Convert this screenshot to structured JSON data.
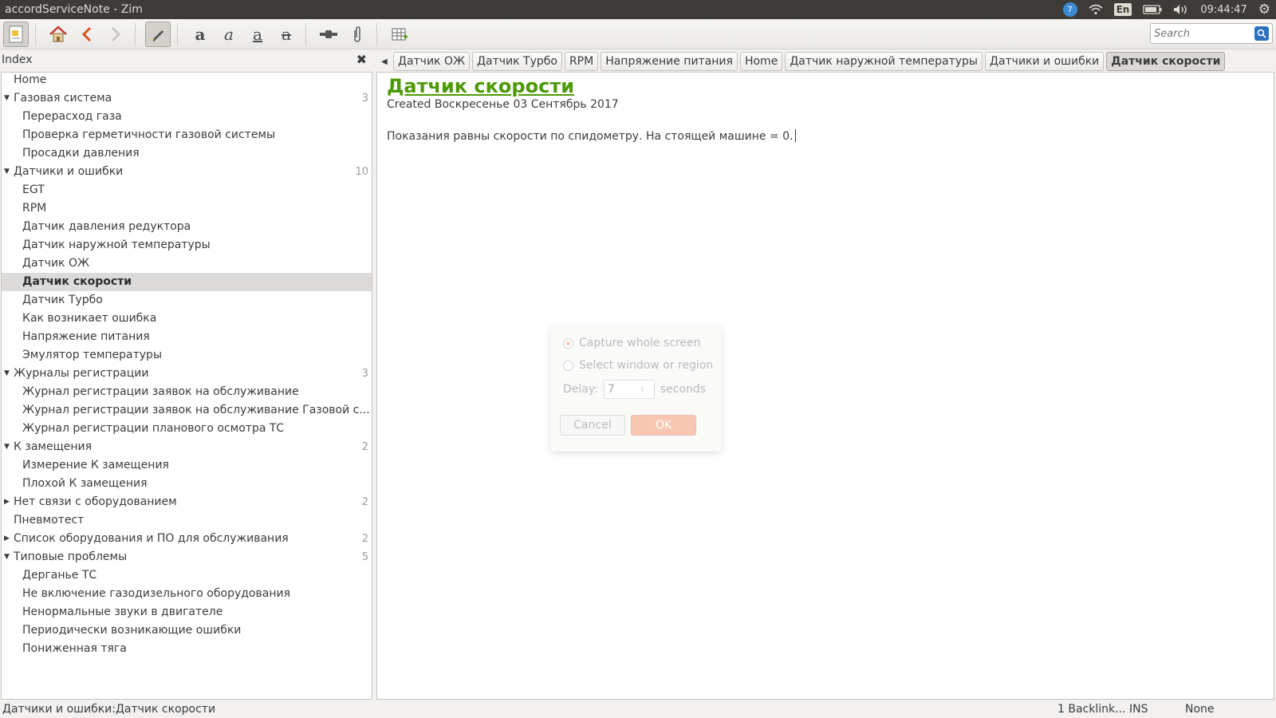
{
  "window": {
    "title": "accordServiceNote - Zim"
  },
  "system_tray": {
    "telegram_badge": "7",
    "keyboard_layout": "En",
    "clock": "09:44:47",
    "icons": [
      "telegram-icon",
      "wifi-icon",
      "keyboard-icon",
      "battery-icon",
      "volume-icon",
      "clock",
      "settings-gear-icon"
    ]
  },
  "toolbar": {
    "buttons": [
      "notebook-icon",
      "home-icon",
      "back-icon",
      "forward-icon",
      "edit-pencil-icon",
      "bold-icon",
      "italic-icon",
      "underline-icon",
      "strikethrough-icon",
      "insert-link-icon",
      "attach-file-icon",
      "table-icon"
    ],
    "search_placeholder": "Search"
  },
  "index": {
    "header": "Index",
    "items": [
      {
        "label": "Home",
        "level": 0,
        "expander": "",
        "count": ""
      },
      {
        "label": "Газовая система",
        "level": 0,
        "expander": "▼",
        "count": "3"
      },
      {
        "label": "Перерасход газа",
        "level": 1,
        "expander": "",
        "count": ""
      },
      {
        "label": "Проверка герметичности газовой системы",
        "level": 1,
        "expander": "",
        "count": ""
      },
      {
        "label": "Просадки давления",
        "level": 1,
        "expander": "",
        "count": ""
      },
      {
        "label": "Датчики и ошибки",
        "level": 0,
        "expander": "▼",
        "count": "10"
      },
      {
        "label": "EGT",
        "level": 1,
        "expander": "",
        "count": ""
      },
      {
        "label": "RPM",
        "level": 1,
        "expander": "",
        "count": ""
      },
      {
        "label": "Датчик давления редуктора",
        "level": 1,
        "expander": "",
        "count": ""
      },
      {
        "label": "Датчик наружной температуры",
        "level": 1,
        "expander": "",
        "count": ""
      },
      {
        "label": "Датчик ОЖ",
        "level": 1,
        "expander": "",
        "count": ""
      },
      {
        "label": "Датчик скорости",
        "level": 1,
        "expander": "",
        "count": "",
        "selected": true
      },
      {
        "label": "Датчик Турбо",
        "level": 1,
        "expander": "",
        "count": ""
      },
      {
        "label": "Как возникает ошибка",
        "level": 1,
        "expander": "",
        "count": ""
      },
      {
        "label": "Напряжение питания",
        "level": 1,
        "expander": "",
        "count": ""
      },
      {
        "label": "Эмулятор температуры",
        "level": 1,
        "expander": "",
        "count": ""
      },
      {
        "label": "Журналы регистрации",
        "level": 0,
        "expander": "▼",
        "count": "3"
      },
      {
        "label": "Журнал регистрации заявок на обслуживание",
        "level": 1,
        "expander": "",
        "count": ""
      },
      {
        "label": "Журнал регистрации заявок на обслуживание Газовой с...",
        "level": 1,
        "expander": "",
        "count": ""
      },
      {
        "label": "Журнал регистрации планового осмотра ТС",
        "level": 1,
        "expander": "",
        "count": ""
      },
      {
        "label": "К замещения",
        "level": 0,
        "expander": "▼",
        "count": "2"
      },
      {
        "label": "Измерение К замещения",
        "level": 1,
        "expander": "",
        "count": ""
      },
      {
        "label": "Плохой К замещения",
        "level": 1,
        "expander": "",
        "count": ""
      },
      {
        "label": "Нет связи с оборудованием",
        "level": 0,
        "expander": "▶",
        "count": "2"
      },
      {
        "label": "Пневмотест",
        "level": 0,
        "expander": "",
        "count": ""
      },
      {
        "label": "Список оборудования и ПО для обслуживания",
        "level": 0,
        "expander": "▶",
        "count": "2"
      },
      {
        "label": "Типовые проблемы",
        "level": 0,
        "expander": "▼",
        "count": "5"
      },
      {
        "label": "Дерганье ТС",
        "level": 1,
        "expander": "",
        "count": ""
      },
      {
        "label": "Не включение газодизельного оборудования",
        "level": 1,
        "expander": "",
        "count": ""
      },
      {
        "label": "Ненормальные звуки в двигателе",
        "level": 1,
        "expander": "",
        "count": ""
      },
      {
        "label": "Периодически возникающие ошибки",
        "level": 1,
        "expander": "",
        "count": ""
      },
      {
        "label": "Пониженная тяга",
        "level": 1,
        "expander": "",
        "count": ""
      }
    ]
  },
  "tabs": [
    {
      "label": "Датчик ОЖ",
      "active": false
    },
    {
      "label": "Датчик Турбо",
      "active": false
    },
    {
      "label": "RPM",
      "active": false
    },
    {
      "label": "Напряжение питания",
      "active": false
    },
    {
      "label": "Home",
      "active": false
    },
    {
      "label": "Датчик наружной температуры",
      "active": false
    },
    {
      "label": "Датчики и ошибки",
      "active": false
    },
    {
      "label": "Датчик скорости",
      "active": true
    }
  ],
  "page": {
    "title": "Датчик скорости",
    "created": "Created Воскресенье 03 Сентябрь 2017",
    "body": "Показания равны скорости по спидометру. На стоящей машине = 0."
  },
  "screenshot_dialog": {
    "option_whole": "Capture whole screen",
    "option_region": "Select window or region",
    "delay_label": "Delay:",
    "delay_value": "7",
    "delay_unit": "seconds",
    "cancel_label": "Cancel",
    "ok_label": "OK"
  },
  "statusbar": {
    "path": "Датчики и ошибки:Датчик скорости",
    "backlinks": "1 Backlink...",
    "mode": "INS",
    "style": "None"
  },
  "colors": {
    "title_green": "#4e9a06",
    "panel_dark": "#3c3b37",
    "accent_orange": "#e9622a"
  }
}
